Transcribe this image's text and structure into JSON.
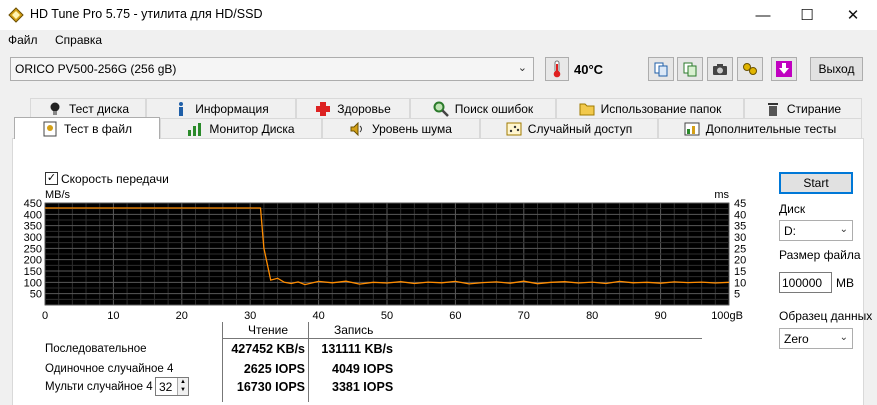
{
  "window": {
    "title": "HD Tune Pro 5.75 - утилита для HD/SSD",
    "minimize": "—",
    "maximize": "☐",
    "close": "✕"
  },
  "menu": {
    "file": "Файл",
    "help": "Справка"
  },
  "toolbar": {
    "drive": "ORICO PV500-256G (256 gB)",
    "temperature": "40°C",
    "exit_label": "Выход"
  },
  "tabs": {
    "row1": [
      "Тест диска",
      "Информация",
      "Здоровье",
      "Поиск ошибок",
      "Использование папок",
      "Стирание"
    ],
    "row2": [
      "Тест в файл",
      "Монитор Диска",
      "Уровень шума",
      "Случайный доступ",
      "Дополнительные тесты"
    ]
  },
  "transfer": {
    "checkbox_label": "Скорость передачи",
    "checked": true
  },
  "chart_data": {
    "type": "line",
    "left_unit": "MB/s",
    "right_unit": "ms",
    "y_ticks": [
      50,
      100,
      150,
      200,
      250,
      300,
      350,
      400,
      450
    ],
    "y_range": [
      0,
      450
    ],
    "y2_ticks": [
      5,
      10,
      15,
      20,
      25,
      30,
      35,
      40,
      45
    ],
    "y2_range": [
      0,
      45
    ],
    "x_ticks": [
      "0",
      "10",
      "20",
      "30",
      "40",
      "50",
      "60",
      "70",
      "80",
      "90",
      "100gB"
    ],
    "x_range": [
      0,
      100
    ],
    "grid": true,
    "series": [
      {
        "color": "#ff8c00",
        "x": [
          0,
          31.5,
          32,
          33,
          34,
          35,
          36,
          37,
          38,
          40,
          42,
          44,
          46,
          48,
          50,
          52,
          54,
          56,
          58,
          60,
          62,
          64,
          66,
          68,
          70,
          72,
          74,
          76,
          78,
          80,
          82,
          84,
          86,
          88,
          90,
          92,
          94,
          96,
          98,
          100
        ],
        "values": [
          428,
          428,
          250,
          110,
          118,
          100,
          95,
          102,
          90,
          104,
          98,
          105,
          92,
          100,
          97,
          103,
          95,
          101,
          98,
          104,
          93,
          99,
          102,
          96,
          105,
          94,
          100,
          103,
          97,
          101,
          95,
          104,
          98,
          100,
          96,
          102,
          99,
          101,
          97,
          100
        ]
      }
    ]
  },
  "results": {
    "col_read": "Чтение",
    "col_write": "Запись",
    "rows": [
      {
        "label": "Последовательное",
        "read": "427452 KB/s",
        "write": "131111 KB/s"
      },
      {
        "label": "Одиночное случайное 4",
        "read": "2625 IOPS",
        "write": "4049 IOPS"
      },
      {
        "label": "Мульти случайное 4",
        "read": "16730 IOPS",
        "write": "3381 IOPS"
      }
    ],
    "queue_depth": "32"
  },
  "controls": {
    "start_label": "Start",
    "disk_label": "Диск",
    "disk_value": "D:",
    "size_label": "Размер файла",
    "size_value": "100000",
    "size_unit": "MB",
    "pattern_label": "Образец данных",
    "pattern_value": "Zero"
  }
}
